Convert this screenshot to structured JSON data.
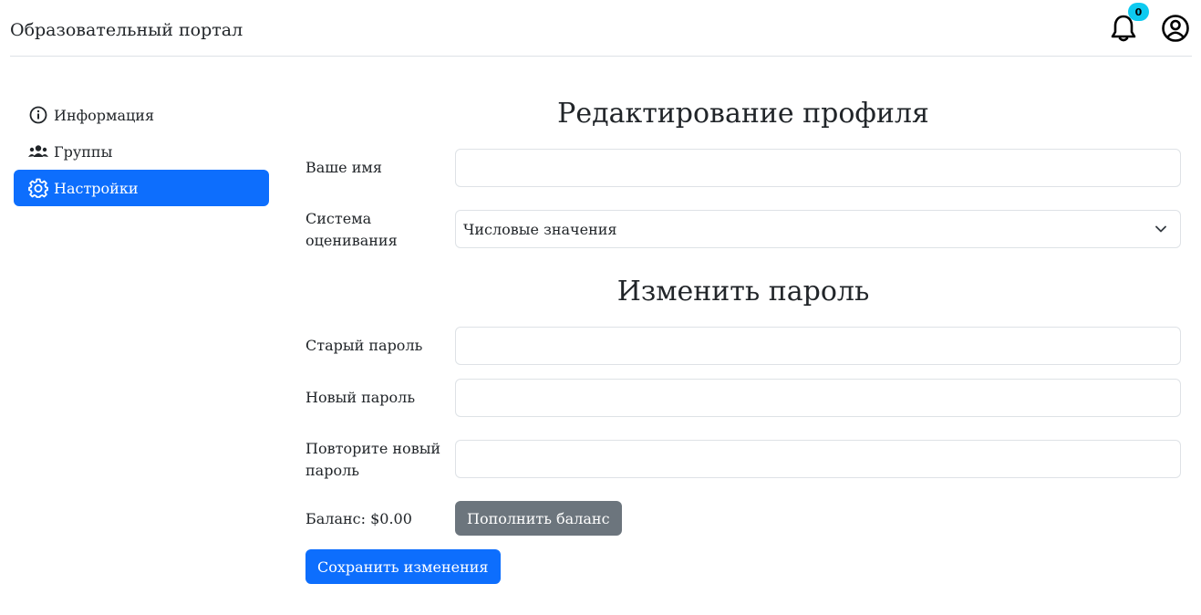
{
  "header": {
    "brand": "Образовательный портал",
    "notifications_count": "0",
    "icons": [
      "bell-icon",
      "user-circle-icon"
    ]
  },
  "sidebar": {
    "items": [
      {
        "label": "Информация",
        "icon": "info-icon",
        "active": false
      },
      {
        "label": "Группы",
        "icon": "people-icon",
        "active": false
      },
      {
        "label": "Настройки",
        "icon": "gear-icon",
        "active": true
      }
    ]
  },
  "profile": {
    "title": "Редактирование профиля",
    "name_label": "Ваше имя",
    "name_value": "",
    "grading_label": "Система оценивания",
    "grading_value": "Числовые значения"
  },
  "password": {
    "title": "Изменить пароль",
    "old_label": "Старый пароль",
    "new_label": "Новый пароль",
    "repeat_label": "Повторите новый пароль"
  },
  "balance": {
    "label": "Баланс: $0.00",
    "topup_button": "Пополнить баланс"
  },
  "save_button": "Сохранить изменения",
  "colors": {
    "primary": "#0d6efd",
    "secondary": "#6c757d",
    "badge": "#0dcaf0",
    "border": "#dee2e6"
  }
}
